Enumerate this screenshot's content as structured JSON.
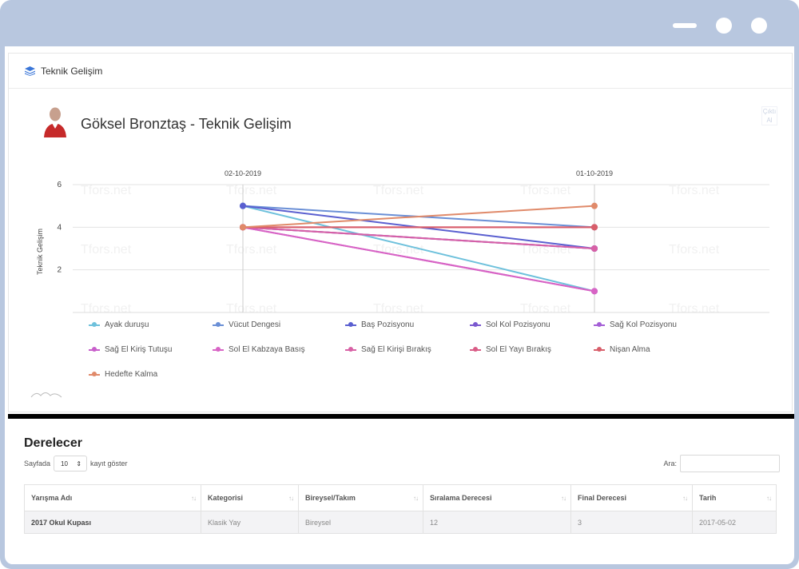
{
  "card": {
    "title": "Teknik Gelişim"
  },
  "report": {
    "title": "Göksel Bronztaş - Teknik Gelişim",
    "print_label": "Çıktı Al"
  },
  "watermark": "Tfors.net",
  "chart_data": {
    "type": "line",
    "x": [
      "02-10-2019",
      "01-10-2019"
    ],
    "ylabel": "Teknik Gelişim",
    "yticks": [
      2,
      4,
      6
    ],
    "ylim": [
      0,
      6
    ],
    "grid": true,
    "legend_position": "bottom",
    "series": [
      {
        "name": "Ayak duruşu",
        "color": "#6ec1dc",
        "values": [
          5,
          1
        ]
      },
      {
        "name": "Vücut Dengesi",
        "color": "#6a8fd6",
        "values": [
          5,
          4
        ]
      },
      {
        "name": "Baş Pozisyonu",
        "color": "#5a5fd0",
        "values": [
          5,
          3
        ]
      },
      {
        "name": "Sol Kol Pozisyonu",
        "color": "#7a58cf",
        "values": [
          4,
          3
        ]
      },
      {
        "name": "Sağ Kol Pozisyonu",
        "color": "#a45fd6",
        "values": [
          4,
          3
        ]
      },
      {
        "name": "Sağ El Kiriş Tutuşu",
        "color": "#c85fcb",
        "values": [
          4,
          1
        ]
      },
      {
        "name": "Sol El Kabzaya Basış",
        "color": "#d864c5",
        "values": [
          4,
          1
        ]
      },
      {
        "name": "Sağ El Kirişi Bırakış",
        "color": "#d861a5",
        "values": [
          4,
          3
        ]
      },
      {
        "name": "Sol El Yayı Bırakış",
        "color": "#d95c86",
        "values": [
          4,
          4
        ]
      },
      {
        "name": "Nişan Alma",
        "color": "#d85e6a",
        "values": [
          4,
          4
        ]
      },
      {
        "name": "Hedefte Kalma",
        "color": "#e08a6a",
        "values": [
          4,
          5
        ]
      }
    ]
  },
  "table_section": {
    "title": "Derelecer",
    "length_prefix": "Sayfada",
    "length_value": "10",
    "length_suffix": "kayıt göster",
    "search_label": "Ara:",
    "columns": [
      "Yarışma Adı",
      "Kategorisi",
      "Bireysel/Takım",
      "Sıralama Derecesi",
      "Final Derecesi",
      "Tarih"
    ],
    "rows": [
      [
        "2017 Okul Kupası",
        "Klasik Yay",
        "Bireysel",
        "12",
        "3",
        "2017-05-02"
      ]
    ]
  }
}
